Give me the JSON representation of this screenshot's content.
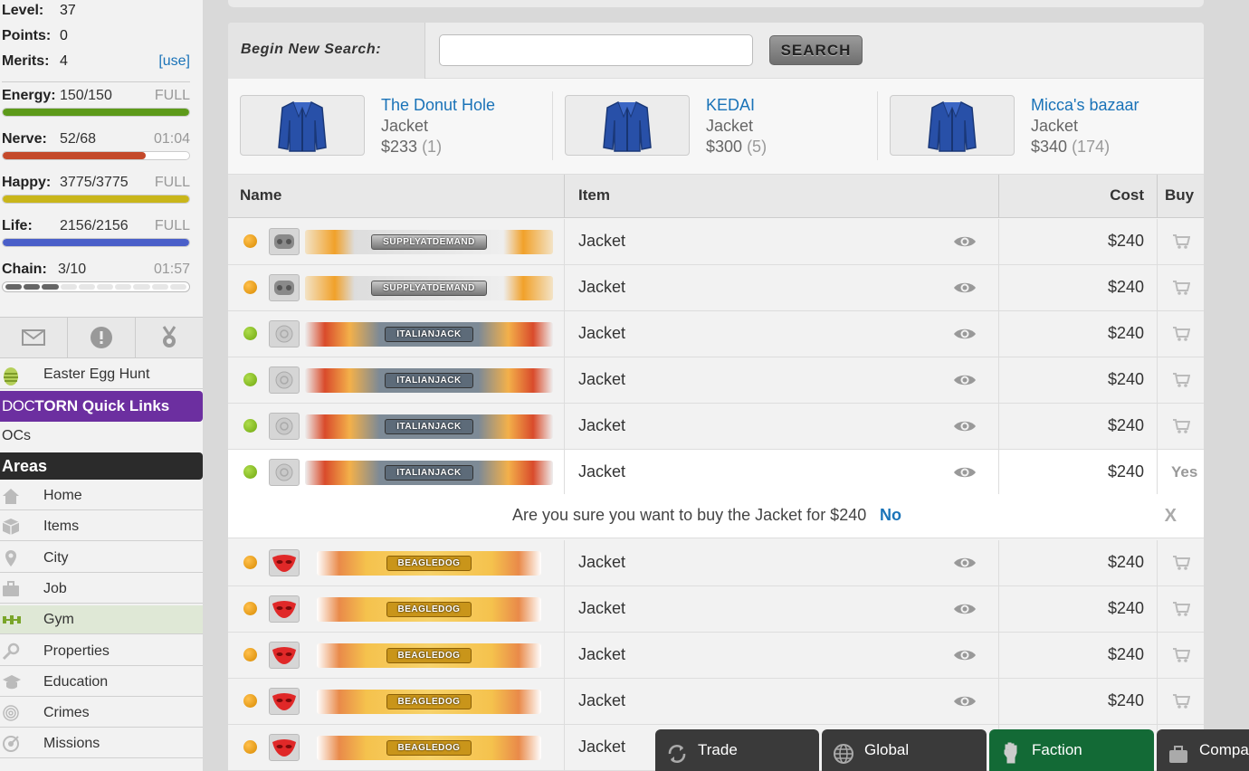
{
  "sidebar": {
    "level_label": "Level:",
    "level_value": "37",
    "points_label": "Points:",
    "points_value": "0",
    "merits_label": "Merits:",
    "merits_value": "4",
    "merits_use": "[use]",
    "bars": [
      {
        "label": "Energy:",
        "value": "150/150",
        "right": "FULL",
        "fill": 1.0,
        "color": "#5d9a1a"
      },
      {
        "label": "Nerve:",
        "value": "52/68",
        "right": "01:04",
        "fill": 0.765,
        "color": "#c4492a"
      },
      {
        "label": "Happy:",
        "value": "3775/3775",
        "right": "FULL",
        "fill": 1.0,
        "color": "#c9b61a"
      },
      {
        "label": "Life:",
        "value": "2156/2156",
        "right": "FULL",
        "fill": 1.0,
        "color": "#4a5fc9"
      }
    ],
    "chain": {
      "label": "Chain:",
      "value": "3/10",
      "right": "01:57",
      "filled": 3,
      "total": 10
    },
    "icons": [
      "mail-icon",
      "alert-icon",
      "medal-icon"
    ],
    "event_link": "Easter Egg Hunt",
    "doctorn_prefix_doc": "DOC",
    "doctorn_prefix_torn": "TORN",
    "doctorn_title": "Quick Links",
    "ocs": "OCs",
    "areas_header": "Areas",
    "areas": [
      "Home",
      "Items",
      "City",
      "Job",
      "Gym",
      "Properties",
      "Education",
      "Crimes",
      "Missions"
    ],
    "active_area": "Gym"
  },
  "search": {
    "label": "Begin New Search:",
    "input_value": "",
    "button": "SEARCH"
  },
  "bazaars": [
    {
      "name": "The Donut Hole",
      "item": "Jacket",
      "price": "$233",
      "qty": "(1)"
    },
    {
      "name": "KEDAI",
      "item": "Jacket",
      "price": "$300",
      "qty": "(5)"
    },
    {
      "name": "Micca's bazaar",
      "item": "Jacket",
      "price": "$340",
      "qty": "(174)"
    }
  ],
  "table": {
    "headers": {
      "name": "Name",
      "item": "Item",
      "cost": "Cost",
      "buy": "Buy"
    },
    "rows": [
      {
        "status": "orange",
        "seller": "SUPPLYATDEMAND",
        "banner": "supply",
        "item": "Jacket",
        "cost": "$240"
      },
      {
        "status": "orange",
        "seller": "SUPPLYATDEMAND",
        "banner": "supply",
        "item": "Jacket",
        "cost": "$240"
      },
      {
        "status": "green",
        "seller": "ITALIANJACK",
        "banner": "italian",
        "item": "Jacket",
        "cost": "$240"
      },
      {
        "status": "green",
        "seller": "ITALIANJACK",
        "banner": "italian",
        "item": "Jacket",
        "cost": "$240"
      },
      {
        "status": "green",
        "seller": "ITALIANJACK",
        "banner": "italian",
        "item": "Jacket",
        "cost": "$240"
      },
      {
        "status": "green",
        "seller": "ITALIANJACK",
        "banner": "italian",
        "item": "Jacket",
        "cost": "$240",
        "buy_text": "Yes"
      },
      {
        "status": "orange",
        "seller": "BEAGLEDOG",
        "banner": "beagle",
        "item": "Jacket",
        "cost": "$240"
      },
      {
        "status": "orange",
        "seller": "BEAGLEDOG",
        "banner": "beagle",
        "item": "Jacket",
        "cost": "$240"
      },
      {
        "status": "orange",
        "seller": "BEAGLEDOG",
        "banner": "beagle",
        "item": "Jacket",
        "cost": "$240"
      },
      {
        "status": "orange",
        "seller": "BEAGLEDOG",
        "banner": "beagle",
        "item": "Jacket",
        "cost": "$240"
      },
      {
        "status": "orange",
        "seller": "BEAGLEDOG",
        "banner": "beagle",
        "item": "Jacket",
        "cost": ""
      }
    ]
  },
  "confirm": {
    "message": "Are you sure you want to buy the Jacket for $240",
    "no": "No",
    "close": "X"
  },
  "chat_tabs": [
    "Trade",
    "Global",
    "Faction",
    "Compar"
  ]
}
